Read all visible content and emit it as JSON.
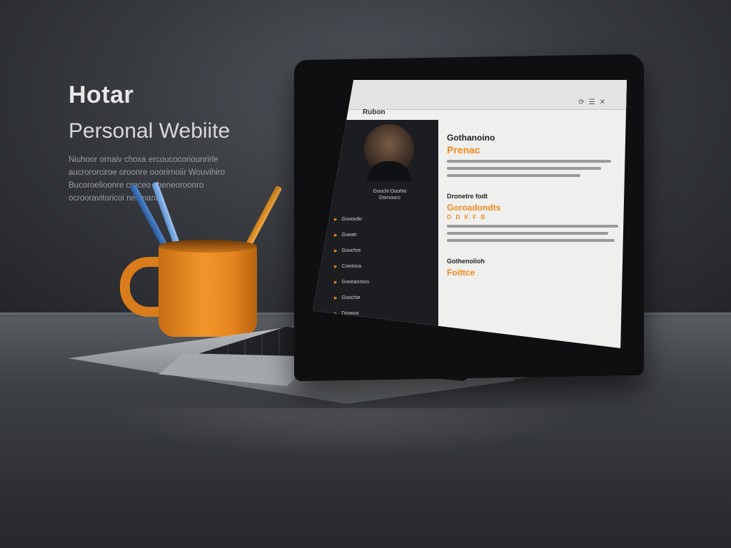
{
  "hero": {
    "title": "Hotar",
    "subtitle": "Personal Webiite",
    "text": "Niuhoor ornaiv choxa ercoucocoriounrirle aucrororciroe oroonre ooorirnoiir Wouvihiro Bucoroelioonre croceo cheneoroonro ocrooravitoricoi neinnaniri."
  },
  "browser": {
    "tab_label": "Rubon"
  },
  "site": {
    "profile_name": "Gouchi Ooohlo",
    "profile_role": "Dornoocc",
    "nav": [
      {
        "icon": "arrow-icon",
        "label": "Goooutlo"
      },
      {
        "icon": "arrow-icon",
        "label": "Gueatr"
      },
      {
        "icon": "arrow-icon",
        "label": "Goochre"
      },
      {
        "icon": "arrow-icon",
        "label": "Cointoca"
      },
      {
        "icon": "arrow-icon",
        "label": "Goooanrovo"
      },
      {
        "icon": "arrow-icon",
        "label": "Goochie"
      },
      {
        "icon": "arrow-icon",
        "label": "Drowoo"
      }
    ],
    "intro": {
      "title": "Gothanoino",
      "accent": "Prenac"
    },
    "section_2": {
      "title": "Dronetre fodt",
      "accent": "Goroadondts",
      "sub": "O D K F B"
    },
    "section_3": {
      "title": "Gothenolioh",
      "accent": "Foittce"
    }
  },
  "colors": {
    "accent": "#f08a1d",
    "background": "#2f3236"
  }
}
